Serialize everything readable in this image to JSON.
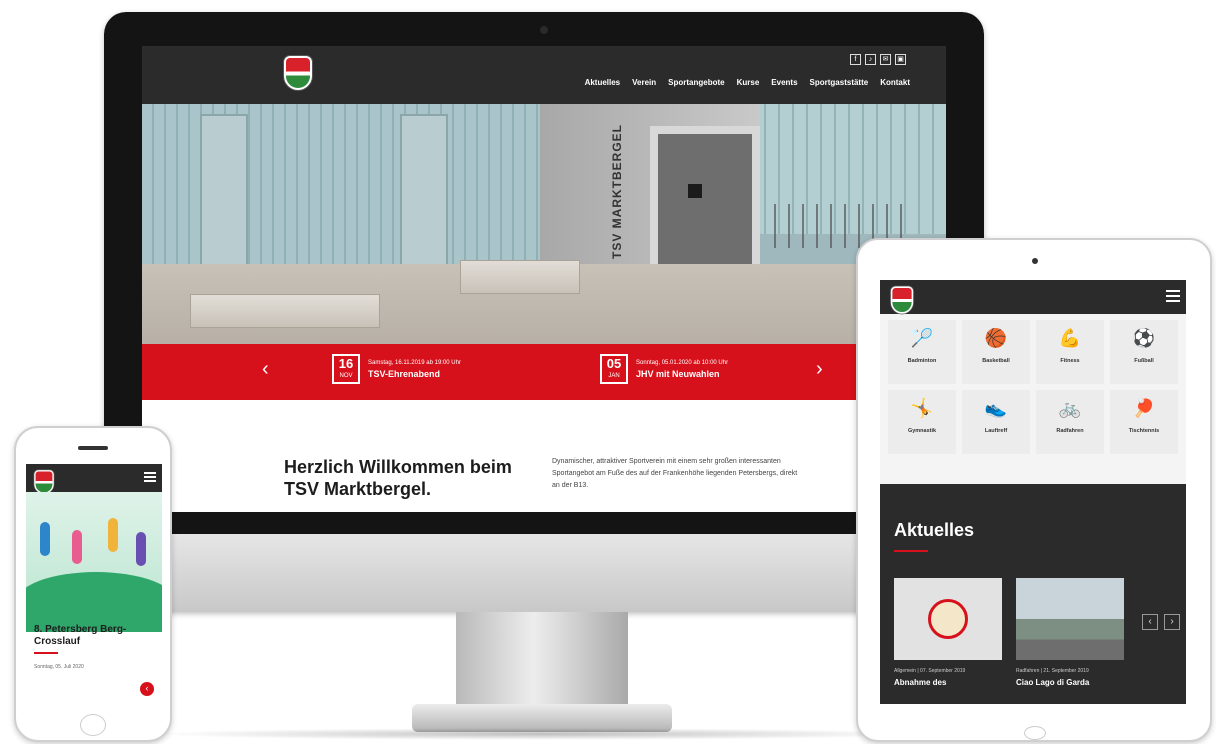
{
  "desktop": {
    "social_icons": [
      "f",
      "♪",
      "✉",
      "▣"
    ],
    "nav": [
      "Aktuelles",
      "Verein",
      "Sportangebote",
      "Kurse",
      "Events",
      "Sportgaststätte",
      "Kontakt"
    ],
    "hero_building_text": "TSV MARKTBERGEL",
    "events": [
      {
        "day": "16",
        "month": "NOV",
        "meta": "Samstag, 16.11.2019 ab 19:00 Uhr",
        "title": "TSV-Ehrenabend"
      },
      {
        "day": "05",
        "month": "JAN",
        "meta": "Sonntag, 05.01.2020 ab 10:00 Uhr",
        "title": "JHV mit Neuwahlen"
      }
    ],
    "welcome": {
      "heading": "Herzlich Willkommen beim TSV Marktbergel.",
      "text": "Dynamischer, attraktiver Sportverein mit einem sehr großen interessanten Sportangebot am Fuße des auf der Frankenhöhe liegenden Petersbergs, direkt an der B13."
    }
  },
  "tablet": {
    "sports": [
      {
        "icon": "badminton-icon",
        "glyph": "🏸",
        "label": "Badminton"
      },
      {
        "icon": "basketball-icon",
        "glyph": "🏀",
        "label": "Basketball"
      },
      {
        "icon": "fitness-icon",
        "glyph": "💪",
        "label": "Fitness"
      },
      {
        "icon": "football-icon",
        "glyph": "⚽",
        "label": "Fußball"
      },
      {
        "icon": "gymnastics-icon",
        "glyph": "🤸",
        "label": "Gymnastik"
      },
      {
        "icon": "running-icon",
        "glyph": "👟",
        "label": "Lauftreff"
      },
      {
        "icon": "cycling-icon",
        "glyph": "🚲",
        "label": "Radfahren"
      },
      {
        "icon": "table-tennis-icon",
        "glyph": "🏓",
        "label": "Tischtennis"
      }
    ],
    "news_heading": "Aktuelles",
    "cards": [
      {
        "meta": "Allgemein  |  07. September 2019",
        "title": "Abnahme des"
      },
      {
        "meta": "Radfahren  |  21. September 2019",
        "title": "Ciao Lago di Garda"
      }
    ],
    "pager": [
      "‹",
      "›"
    ]
  },
  "phone": {
    "title": "8. Petersberg Berg-Crosslauf",
    "meta": "Sonntag, 05. Juli 2020",
    "button": "‹"
  },
  "colors": {
    "brand_red": "#d7111b",
    "header_dark": "#2b2b2b"
  }
}
